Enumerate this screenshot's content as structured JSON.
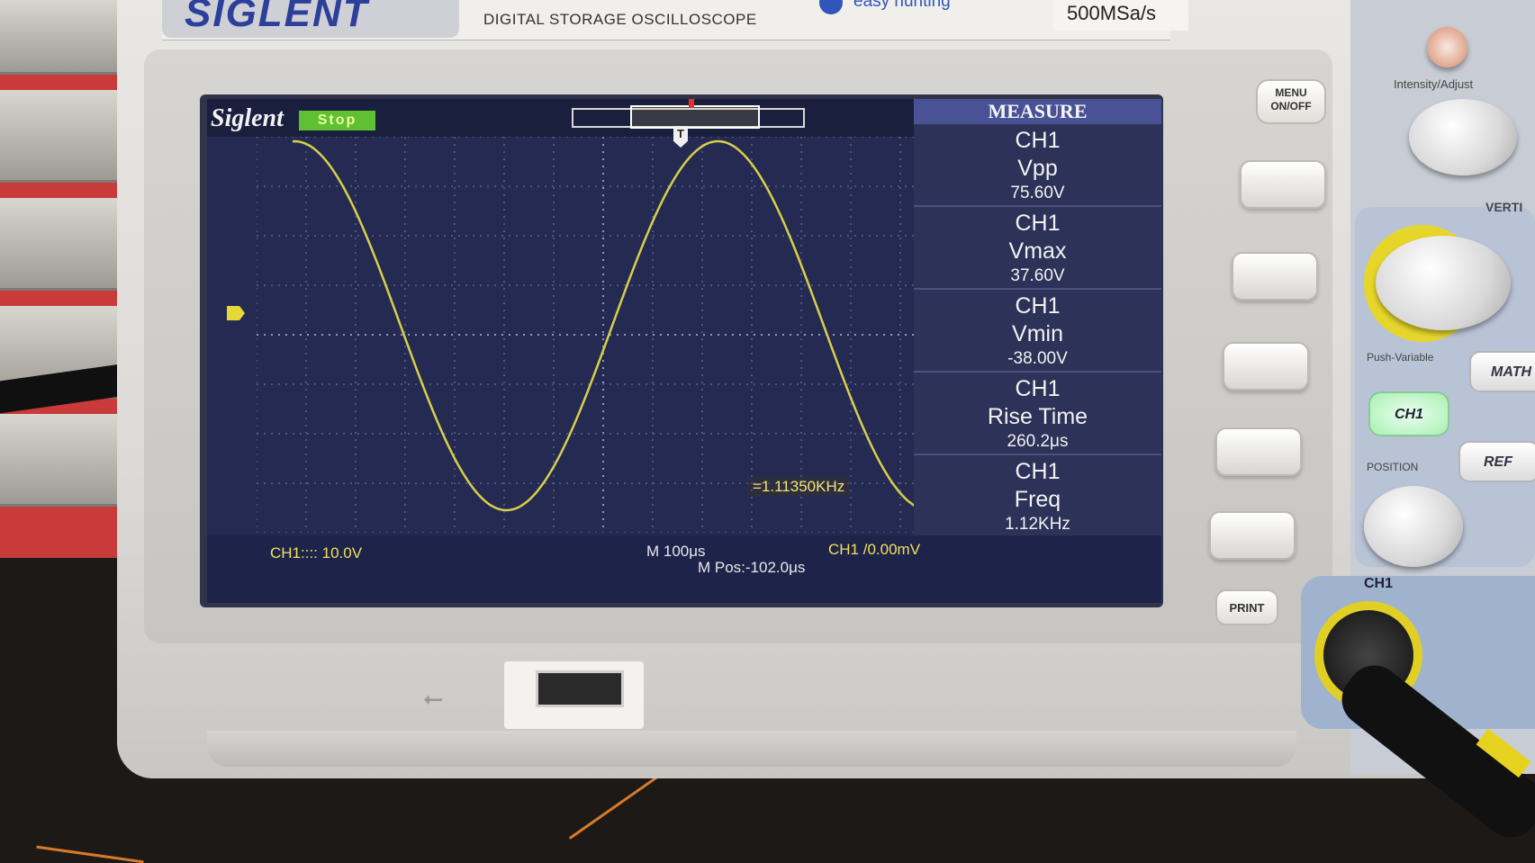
{
  "header": {
    "brand": "SIGLENT",
    "model_subtitle": "DIGITAL STORAGE OSCILLOSCOPE",
    "easy_text": "easy hunting",
    "sample_rate": "500MSa/s"
  },
  "screen": {
    "logo": "Siglent",
    "status": "Stop",
    "trigger_marker": "T",
    "measure": {
      "title": "MEASURE",
      "items": [
        {
          "channel": "CH1",
          "name": "Vpp",
          "value": "75.60V"
        },
        {
          "channel": "CH1",
          "name": "Vmax",
          "value": "37.60V"
        },
        {
          "channel": "CH1",
          "name": "Vmin",
          "value": "-38.00V"
        },
        {
          "channel": "CH1",
          "name": "Rise Time",
          "value": "260.2μs"
        },
        {
          "channel": "CH1",
          "name": "Freq",
          "value": "1.12KHz"
        }
      ]
    },
    "freq_counter": "=1.11350KHz",
    "bottom": {
      "ch1_scale": "CH1:::: 10.0V",
      "timebase": "M 100μs",
      "m_pos": "M Pos:-102.0μs",
      "trigger": "CH1 /0.00mV"
    }
  },
  "buttons": {
    "menu": "MENU ON/OFF",
    "print": "PRINT"
  },
  "panel": {
    "intensity": "Intensity/Adjust",
    "vertical": "VERTI",
    "push_variable": "Push-Variable",
    "ch1": "CH1",
    "math": "MATH",
    "ref": "REF",
    "position": "POSITION",
    "ch1_input": "CH1"
  },
  "colors": {
    "trace": "#d8cf4a",
    "screen_bg": "#242a52",
    "measure_title_bg": "#4a5296",
    "stop_badge": "#5fbf35"
  },
  "icons": [
    "usb-icon",
    "printer-icon",
    "trigger-t-icon",
    "ch1-level-marker-icon"
  ]
}
